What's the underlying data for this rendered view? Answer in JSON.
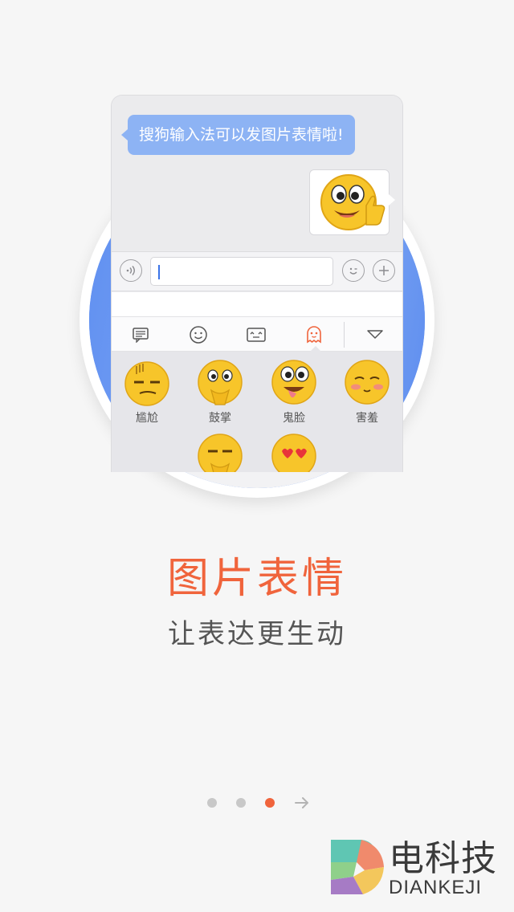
{
  "chat": {
    "incoming_message": "搜狗输入法可以发图片表情啦!",
    "outgoing_sticker": "thumbs-up-smiley-sticker"
  },
  "input_bar": {
    "voice_icon": "voice-icon",
    "emoji_icon": "wink-emoji-icon",
    "add_icon": "plus-icon",
    "text_value": ""
  },
  "keyboard_tabs": [
    {
      "icon": "text-message-icon",
      "active": false
    },
    {
      "icon": "smiley-icon",
      "active": false
    },
    {
      "icon": "kaomoji-icon",
      "active": false
    },
    {
      "icon": "ghost-icon",
      "active": true
    },
    {
      "icon": "collapse-triangle-icon",
      "active": false
    }
  ],
  "emojis": {
    "items": [
      {
        "label": "尴尬"
      },
      {
        "label": "鼓掌"
      },
      {
        "label": "鬼脸"
      },
      {
        "label": "害羞"
      }
    ]
  },
  "headline": "图片表情",
  "subline": "让表达更生动",
  "pager": {
    "pages": 3,
    "current": 3
  },
  "logo": {
    "cn": "电科技",
    "en": "DIANKEJI"
  },
  "colors": {
    "accent": "#f0643c",
    "bubble_blue": "#8db3f4",
    "circle_blue": "#6f9bf3",
    "emoji_yellow": "#f7c52a"
  }
}
